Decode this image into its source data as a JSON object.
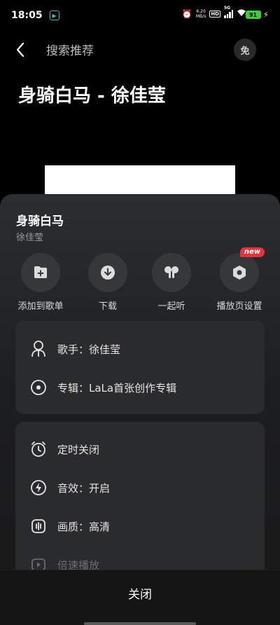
{
  "status_bar": {
    "time": "18:05",
    "speed_value": "6.20",
    "speed_unit": "MB/s",
    "hd": "HD",
    "network": "5G",
    "battery": "91"
  },
  "header": {
    "title": "搜索推荐",
    "free_badge": "免"
  },
  "song_heading": "身骑白马 - 徐佳莹",
  "sheet": {
    "title": "身骑白马",
    "artist": "徐佳莹",
    "actions": [
      {
        "label": "添加到歌单",
        "icon": "folder-add-icon"
      },
      {
        "label": "下载",
        "icon": "download-icon"
      },
      {
        "label": "一起听",
        "icon": "earbuds-icon"
      },
      {
        "label": "播放页设置",
        "icon": "hexagon-settings-icon",
        "badge": "new"
      }
    ],
    "info_rows": [
      {
        "label": "歌手：徐佳莹",
        "icon": "singer-icon"
      },
      {
        "label": "专辑：LaLa首张创作专辑",
        "icon": "album-icon"
      }
    ],
    "settings_rows": [
      {
        "label": "定时关闭",
        "icon": "alarm-clock-icon"
      },
      {
        "label": "音效：开启",
        "icon": "lightning-icon"
      },
      {
        "label": "画质：高清",
        "icon": "quality-icon"
      },
      {
        "label": "倍速播放",
        "icon": "speed-play-icon"
      }
    ],
    "close_label": "关闭"
  },
  "colors": {
    "badge_red": "#e8323c",
    "battery_green": "#3ccf3c",
    "sheet_bg": "#2b2e31",
    "card_bg": "#2a2b2d"
  }
}
